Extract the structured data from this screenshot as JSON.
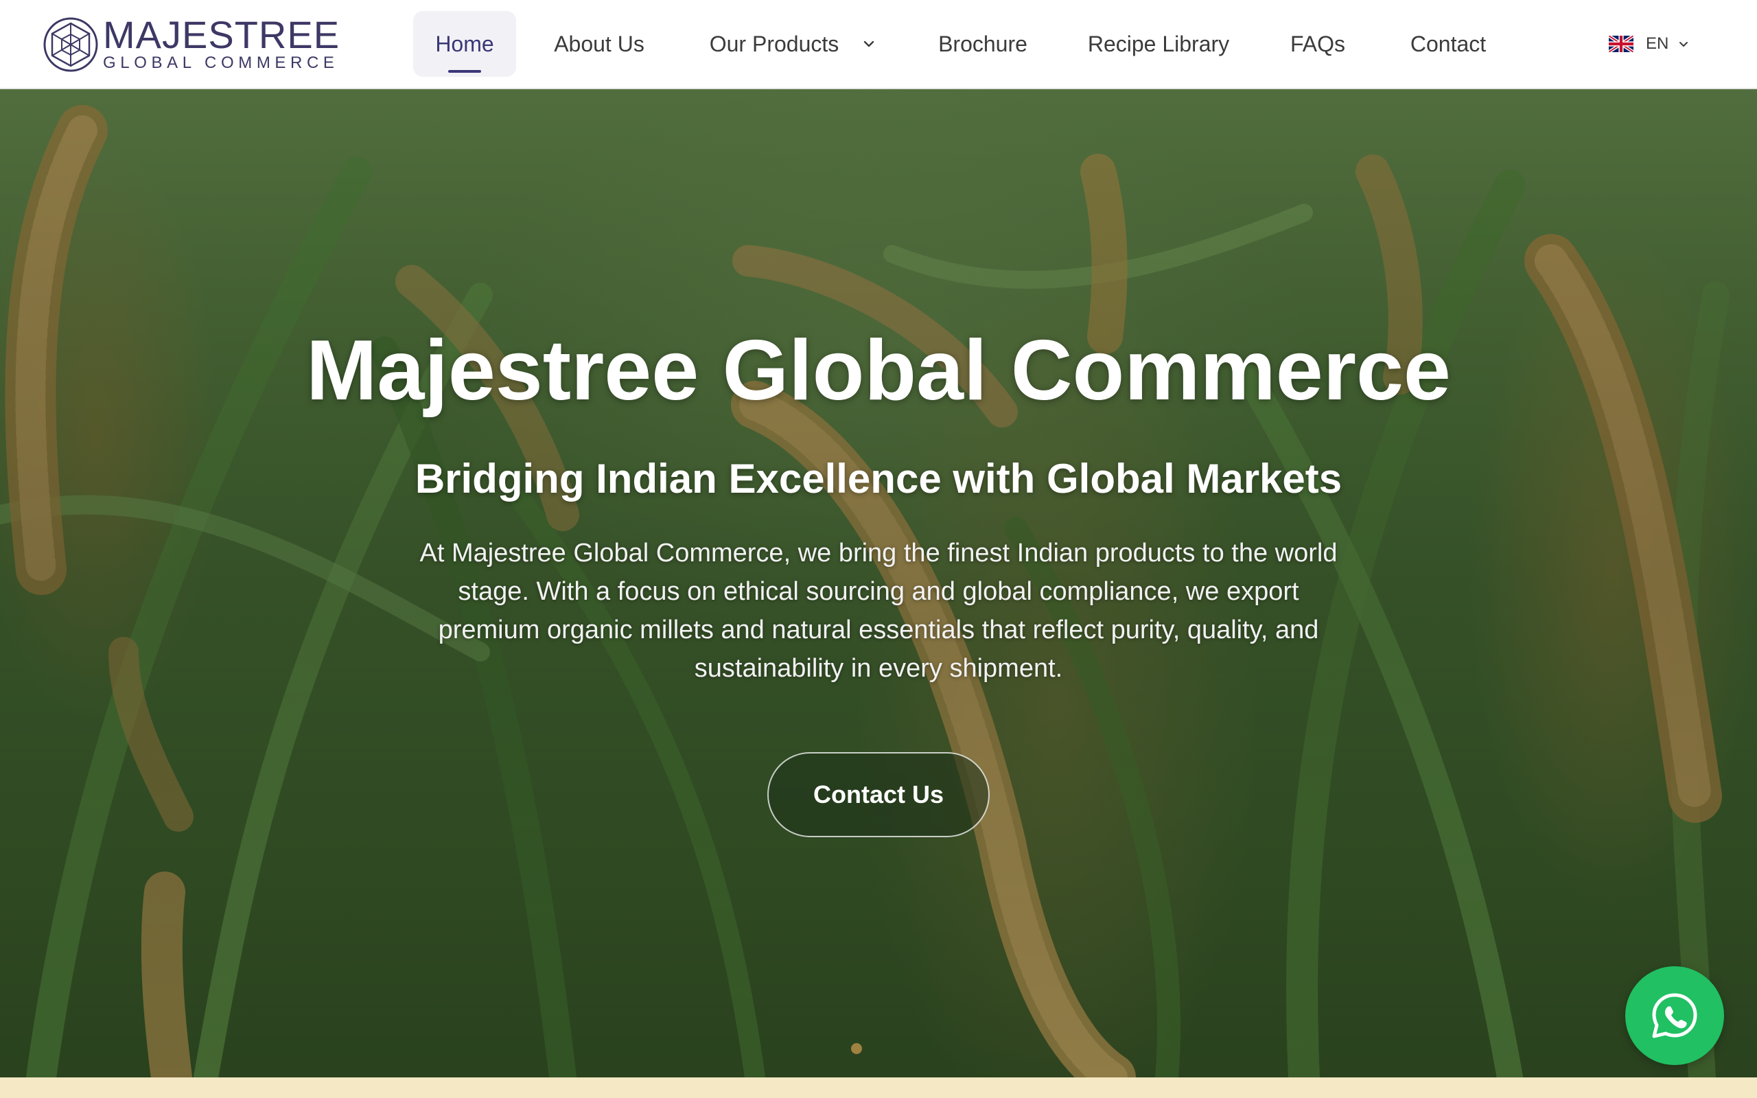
{
  "brand": {
    "name": "MAJESTREE",
    "tagline": "GLOBAL COMMERCE",
    "logo_icon": "hexagon-cube-logo-icon",
    "color": "#3d3865"
  },
  "nav": {
    "items": [
      {
        "label": "Home",
        "active": true
      },
      {
        "label": "About Us"
      },
      {
        "label": "Our Products",
        "has_dropdown": true
      },
      {
        "label": "Brochure"
      },
      {
        "label": "Recipe Library"
      },
      {
        "label": "FAQs"
      },
      {
        "label": "Contact"
      }
    ],
    "active_color": "#3a3777"
  },
  "language": {
    "code": "EN",
    "flag_icon": "uk-flag-icon",
    "caret_icon": "chevron-down-icon"
  },
  "hero": {
    "title": "Majestree Global Commerce",
    "subtitle": "Bridging Indian Excellence with Global Markets",
    "body": "At Majestree Global Commerce, we bring the finest Indian products to the world stage. With a focus on ethical sourcing and global compliance, we export premium organic millets and natural essentials that reflect purity, quality, and sustainability in every shipment.",
    "cta_label": "Contact Us",
    "background": "millet-field-photo"
  },
  "carousel": {
    "dot_count": 1,
    "active_index": 0
  },
  "whatsapp": {
    "icon": "whatsapp-icon",
    "color": "#20c063"
  },
  "colors": {
    "footer_strip": "#f4e8c5"
  }
}
